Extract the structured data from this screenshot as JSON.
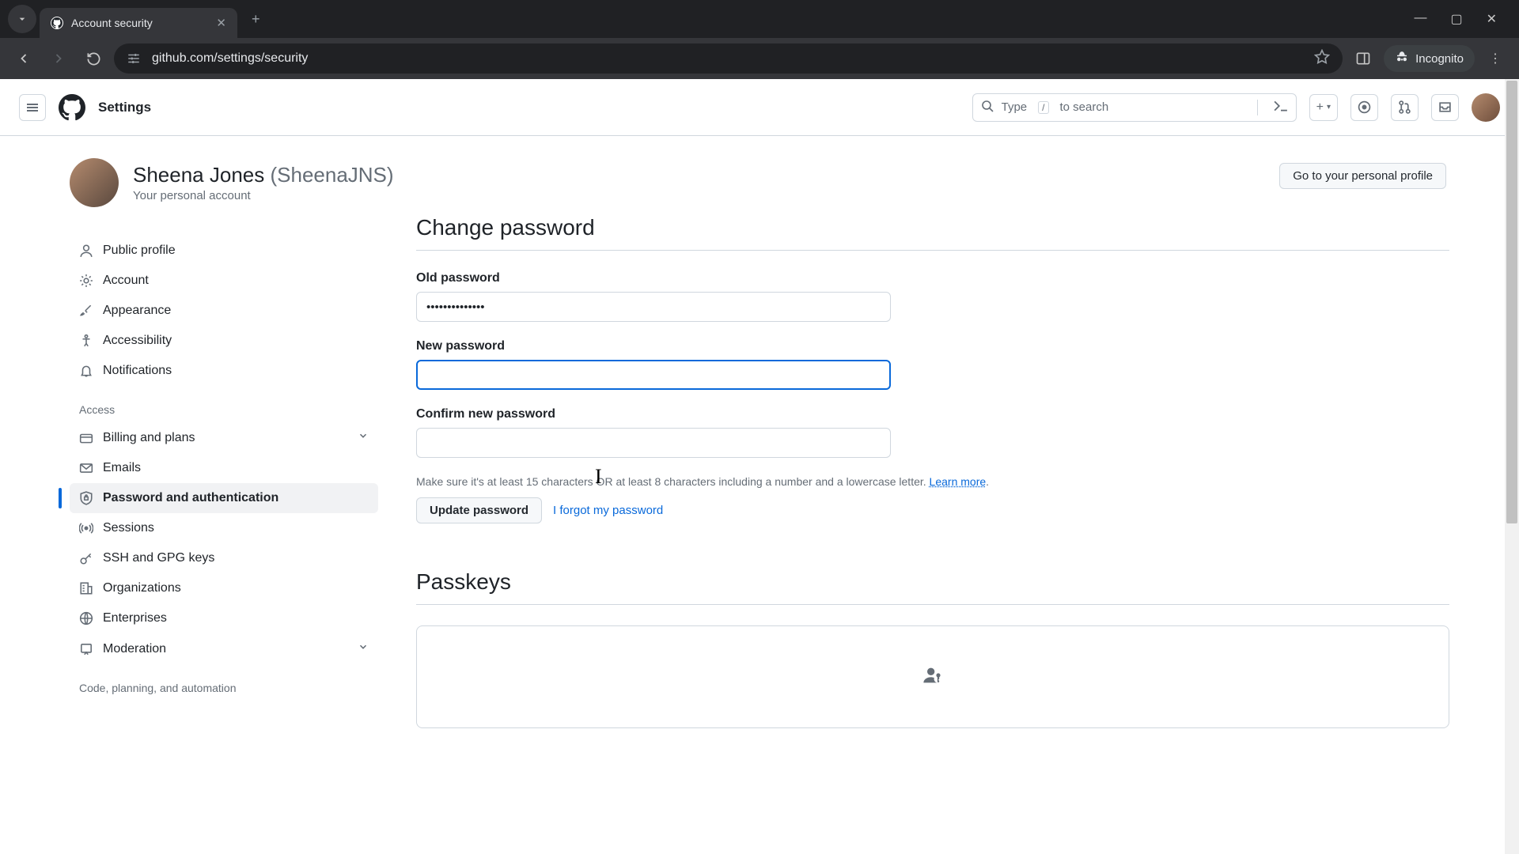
{
  "browser": {
    "tab_title": "Account security",
    "url": "github.com/settings/security",
    "incognito_label": "Incognito"
  },
  "header": {
    "title": "Settings",
    "search_prefix": "Type",
    "search_key": "/",
    "search_suffix": "to search"
  },
  "profile": {
    "name": "Sheena Jones",
    "handle": "(SheenaJNS)",
    "subtitle": "Your personal account",
    "go_profile_btn": "Go to your personal profile"
  },
  "sidebar": {
    "items_top": [
      {
        "label": "Public profile"
      },
      {
        "label": "Account"
      },
      {
        "label": "Appearance"
      },
      {
        "label": "Accessibility"
      },
      {
        "label": "Notifications"
      }
    ],
    "access_heading": "Access",
    "items_access": [
      {
        "label": "Billing and plans"
      },
      {
        "label": "Emails"
      },
      {
        "label": "Password and authentication"
      },
      {
        "label": "Sessions"
      },
      {
        "label": "SSH and GPG keys"
      },
      {
        "label": "Organizations"
      },
      {
        "label": "Enterprises"
      },
      {
        "label": "Moderation"
      }
    ],
    "code_heading": "Code, planning, and automation"
  },
  "main": {
    "change_password_heading": "Change password",
    "old_pw_label": "Old password",
    "old_pw_value": "••••••••••••••",
    "new_pw_label": "New password",
    "new_pw_value": "",
    "confirm_pw_label": "Confirm new password",
    "confirm_pw_value": "",
    "hint_text_1": "Make sure it's at least 15 characters OR at least 8 characters including a number and a lowercase letter. ",
    "hint_link": "Learn more",
    "hint_text_2": ".",
    "update_btn": "Update password",
    "forgot_link": "I forgot my password",
    "passkeys_heading": "Passkeys"
  }
}
